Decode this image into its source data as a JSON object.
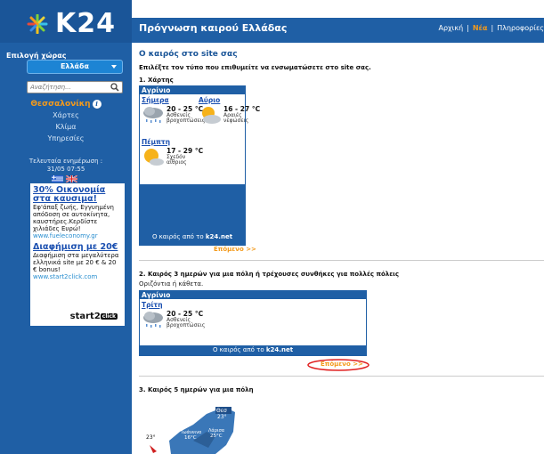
{
  "logo": {
    "text": "K24"
  },
  "sidebar": {
    "country_label": "Επιλογή χώρας",
    "country_value": "Ελλάδα",
    "search_placeholder": "Αναζήτηση...",
    "city": "Θεσσαλονίκη",
    "links": [
      {
        "label": "Χάρτες"
      },
      {
        "label": "Κλίμα"
      },
      {
        "label": "Υπηρεσίες"
      }
    ],
    "update_label": "Τελευταία ενημέρωση :",
    "update_time": "31/05 07:55"
  },
  "ad": {
    "title1": "30% Οικονομία στα καυσιμα!",
    "body1": "Εφ'άπαξ ζωής, Εγγυημένη απόδοση σε αυτοκίνητα, καυστήρες.Κερδίστε χιλιάδες Ευρώ!",
    "url1": "www.fueleconomy.gr",
    "title2": "Διαφήμιση με 20€",
    "body2": "Διαφήμιση στα μεγαλύτερα ελληνικά site με 20 € & 20 € bonus!",
    "url2": "www.start2click.com",
    "brand": "start2",
    "brand_tag": "click"
  },
  "header": {
    "title": "Πρόγνωση καιρού Ελλάδας",
    "nav": [
      "Αρχική",
      "Νέα",
      "Πληροφορίες"
    ],
    "active_nav": 1
  },
  "main": {
    "title": "Ο καιρός στο site σας",
    "intro": "Επιλέξτε τον τύπο που επιθυμείτε να ενσωματώσετε στο site σας.",
    "section1": {
      "title": "1. Χάρτης",
      "widget_city": "Αγρίνιο",
      "days": [
        {
          "name": "Σήμερα",
          "temp": "20 - 25 °C",
          "desc": "Ασθενείς βροχοπτώσεις",
          "icon": "rain-cloud-icon"
        },
        {
          "name": "Αύριο",
          "temp": "16 - 27 °C",
          "desc": "Αραιές νεφώσεις",
          "icon": "sun-cloud-icon"
        },
        {
          "name": "Πέμπτη",
          "temp": "17 - 29 °C",
          "desc": "Σχεδόν αίθριος",
          "icon": "sun-cloud-icon"
        }
      ],
      "footer_text": "Ο καιρός από το ",
      "footer_brand": "k24.net",
      "next": "Επόμενο >>"
    },
    "section2": {
      "title": "2. Καιρός 3 ημερών για μια πόλη ή τρέχουσες συνθήκες για πολλές πόλεις",
      "subtitle": "Οριζόντια ή κάθετα.",
      "widget_city": "Αγρίνιο",
      "day": {
        "name": "Τρίτη",
        "temp": "20 - 25 °C",
        "desc": "Ασθενείς βροχοπτώσεις",
        "icon": "rain-cloud-icon"
      },
      "footer_text": "Ο καιρός από το ",
      "footer_brand": "k24.net",
      "next": "Επόμενο >>"
    },
    "section3": {
      "title": "3. Καιρός 5 ημερών για μια πόλη",
      "map_labels": [
        "Θεσ",
        "23°",
        "Ιωάννινα",
        "16°C",
        "Λάρισα",
        "25°C",
        "23°"
      ]
    }
  },
  "colors": {
    "brand_blue": "#1f5fa5",
    "accent_orange": "#f39a1c",
    "link_blue": "#1a4fb0"
  }
}
